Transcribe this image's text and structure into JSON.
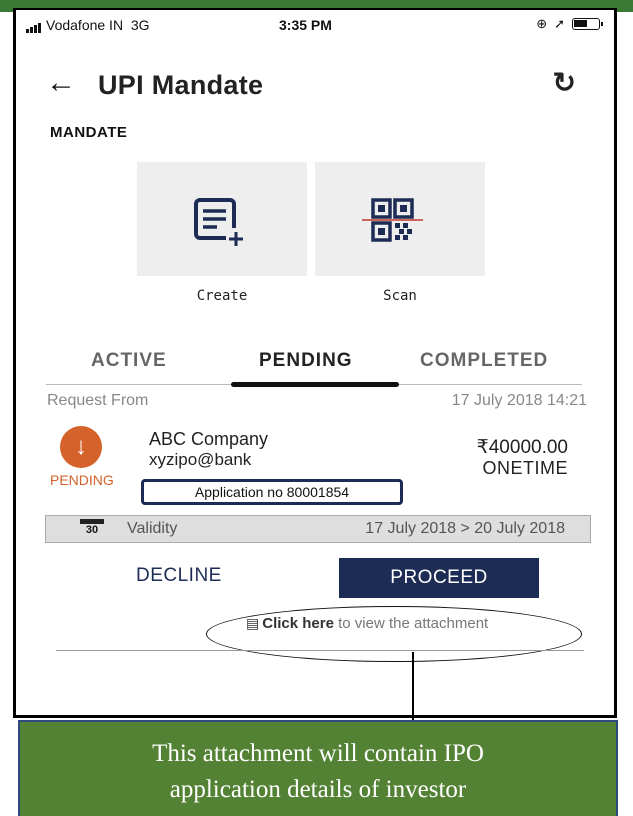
{
  "status_bar": {
    "carrier": "Vodafone IN",
    "network": "3G",
    "time": "3:35 PM",
    "icons": [
      "signal-icon",
      "lock-rotation-icon",
      "location-arrow-icon",
      "battery-icon"
    ]
  },
  "header": {
    "title": "UPI Mandate",
    "back_icon": "arrow-left-icon",
    "refresh_icon": "refresh-icon"
  },
  "mandate_section": {
    "label": "MANDATE",
    "actions": [
      {
        "label": "Create",
        "icon": "create-document-icon"
      },
      {
        "label": "Scan",
        "icon": "qr-scan-icon"
      }
    ]
  },
  "tabs": {
    "items": [
      {
        "label": "ACTIVE"
      },
      {
        "label": "PENDING"
      },
      {
        "label": "COMPLETED"
      }
    ],
    "selected": "PENDING"
  },
  "request": {
    "from_label": "Request From",
    "datetime": "17 July 2018 14:21",
    "status": "PENDING",
    "company": "ABC Company",
    "vpa": "xyzipo@bank",
    "amount": "₹40000.00",
    "frequency": "ONETIME",
    "application_no": "Application no 80001854",
    "validity_label": "Validity",
    "validity_range": "17 July 2018 > 20 July 2018",
    "calendar_day": "30"
  },
  "actions": {
    "decline_label": "DECLINE",
    "proceed_label": "PROCEED"
  },
  "attachment": {
    "click_label": "Click here",
    "rest_label": "to view the attachment"
  },
  "callout": {
    "line1": "This attachment will contain IPO",
    "line2": "application details of investor"
  },
  "colors": {
    "navy": "#1d2c55",
    "pending_orange": "#d4622a",
    "callout_green": "#548235",
    "tile_gray": "#eeeeee"
  }
}
